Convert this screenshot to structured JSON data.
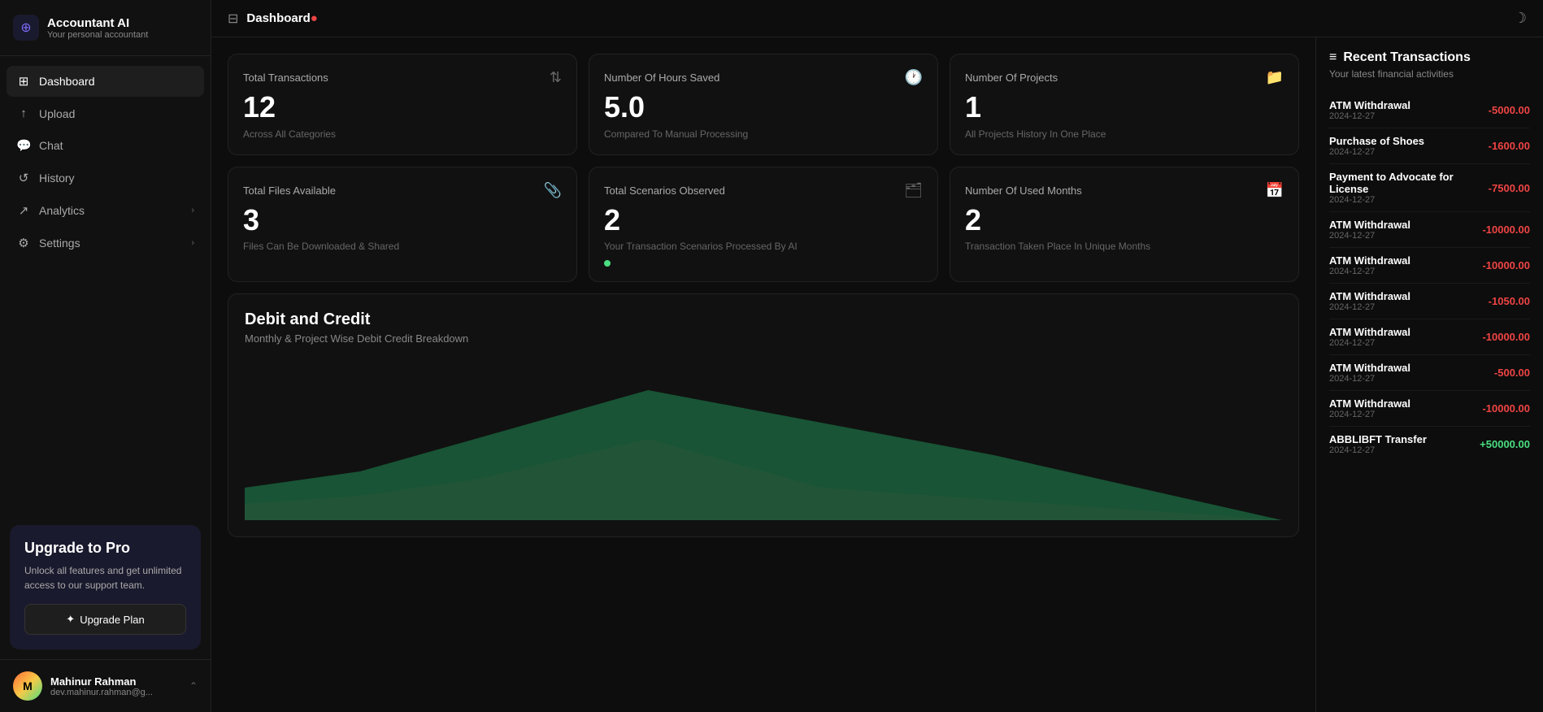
{
  "app": {
    "name": "Accountant AI",
    "subtitle": "Your personal accountant"
  },
  "topbar": {
    "icon": "⊞",
    "title": "Dashboard",
    "dot": "●"
  },
  "sidebar": {
    "nav_items": [
      {
        "id": "dashboard",
        "label": "Dashboard",
        "icon": "⊞",
        "active": true,
        "has_chevron": false
      },
      {
        "id": "upload",
        "label": "Upload",
        "icon": "↑",
        "active": false,
        "has_chevron": false
      },
      {
        "id": "chat",
        "label": "Chat",
        "icon": "💬",
        "active": false,
        "has_chevron": false
      },
      {
        "id": "history",
        "label": "History",
        "icon": "↺",
        "active": false,
        "has_chevron": false
      },
      {
        "id": "analytics",
        "label": "Analytics",
        "icon": "↗",
        "active": false,
        "has_chevron": true
      },
      {
        "id": "settings",
        "label": "Settings",
        "icon": "⚙",
        "active": false,
        "has_chevron": true
      }
    ],
    "upgrade": {
      "title": "Upgrade to Pro",
      "description": "Unlock all features and get unlimited access to our support team.",
      "button_label": "Upgrade Plan",
      "button_icon": "✦"
    },
    "user": {
      "name": "Mahinur Rahman",
      "email": "dev.mahinur.rahman@g..."
    }
  },
  "stats": [
    {
      "id": "total-transactions",
      "title": "Total Transactions",
      "value": "12",
      "description": "Across All Categories",
      "icon": "⇅"
    },
    {
      "id": "hours-saved",
      "title": "Number Of Hours Saved",
      "value": "5.0",
      "description": "Compared To Manual Processing",
      "icon": "🕐"
    },
    {
      "id": "num-projects",
      "title": "Number Of Projects",
      "value": "1",
      "description": "All Projects History In One Place",
      "icon": "📁"
    },
    {
      "id": "total-files",
      "title": "Total Files Available",
      "value": "3",
      "description": "Files Can Be Downloaded & Shared",
      "icon": "📎"
    },
    {
      "id": "total-scenarios",
      "title": "Total Scenarios Observed",
      "value": "2",
      "description": "Your Transaction Scenarios Processed By AI",
      "icon": "🗂",
      "has_indicator": true
    },
    {
      "id": "used-months",
      "title": "Number Of Used Months",
      "value": "2",
      "description": "Transaction Taken Place In Unique Months",
      "icon": "📅"
    }
  ],
  "chart": {
    "title": "Debit and Credit",
    "subtitle": "Monthly & Project Wise Debit Credit Breakdown"
  },
  "right_panel": {
    "title": "Recent Transactions",
    "subtitle": "Your latest financial activities",
    "icon": "≡",
    "transactions": [
      {
        "name": "ATM Withdrawal",
        "date": "2024-12-27",
        "amount": "-5000.00",
        "type": "negative"
      },
      {
        "name": "Purchase of Shoes",
        "date": "2024-12-27",
        "amount": "-1600.00",
        "type": "negative"
      },
      {
        "name": "Payment to Advocate for License",
        "date": "2024-12-27",
        "amount": "-7500.00",
        "type": "negative"
      },
      {
        "name": "ATM Withdrawal",
        "date": "2024-12-27",
        "amount": "-10000.00",
        "type": "negative"
      },
      {
        "name": "ATM Withdrawal",
        "date": "2024-12-27",
        "amount": "-10000.00",
        "type": "negative"
      },
      {
        "name": "ATM Withdrawal",
        "date": "2024-12-27",
        "amount": "-1050.00",
        "type": "negative"
      },
      {
        "name": "ATM Withdrawal",
        "date": "2024-12-27",
        "amount": "-10000.00",
        "type": "negative"
      },
      {
        "name": "ATM Withdrawal",
        "date": "2024-12-27",
        "amount": "-500.00",
        "type": "negative"
      },
      {
        "name": "ATM Withdrawal",
        "date": "2024-12-27",
        "amount": "-10000.00",
        "type": "negative"
      },
      {
        "name": "ABBLIBFT Transfer",
        "date": "2024-12-27",
        "amount": "+50000.00",
        "type": "positive"
      }
    ]
  }
}
